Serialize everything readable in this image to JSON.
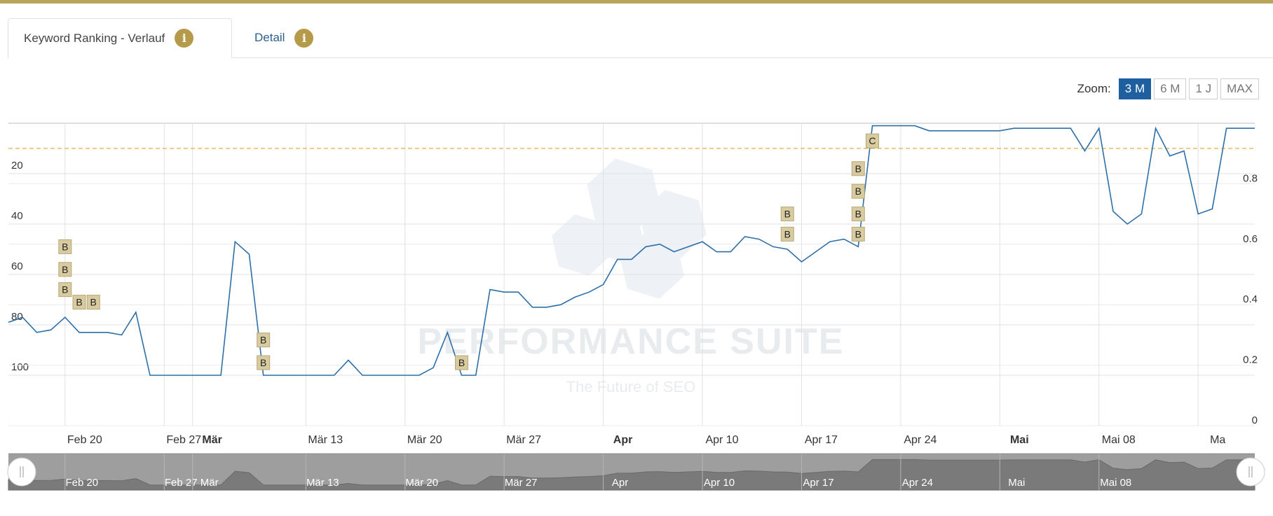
{
  "tabs": [
    {
      "label": "Keyword Ranking - Verlauf",
      "icon": "info-icon",
      "active": true
    },
    {
      "label": "Detail",
      "icon": "info-icon",
      "active": false
    }
  ],
  "zoom": {
    "label": "Zoom:",
    "options": [
      "3 M",
      "6 M",
      "1 J",
      "MAX"
    ],
    "selected": "3 M"
  },
  "watermark": {
    "title": "PERFORMANCE SUITE",
    "subtitle": "The Future of SEO"
  },
  "colors": {
    "topbar": "#b9a55a",
    "line": "#2e6fa8",
    "threshold": "#e0b040",
    "marker_fill": "#d8cba0",
    "marker_stroke": "#b8a878",
    "zoom_active": "#1e5fa0",
    "info_icon": "#b59a4a"
  },
  "chart_data": {
    "type": "line",
    "title": "",
    "xlabel": "",
    "ylabel": "",
    "y_left": {
      "ticks": [
        "20",
        "40",
        "60",
        "80",
        "100"
      ],
      "reversed": true,
      "range": [
        0,
        120
      ]
    },
    "y_right": {
      "ticks": [
        "0",
        "0.2",
        "0.4",
        "0.6",
        "0.8"
      ],
      "range": [
        0,
        1
      ]
    },
    "x_range": [
      "2023-02-16",
      "2023-05-15"
    ],
    "x_ticks": [
      {
        "label": "Feb 20",
        "date": "2023-02-20",
        "bold": false
      },
      {
        "label": "Feb 27",
        "date": "2023-02-27",
        "bold": false
      },
      {
        "label": "Mär",
        "date": "2023-03-01",
        "bold": true
      },
      {
        "label": "Mär 13",
        "date": "2023-03-09",
        "bold": false
      },
      {
        "label": "Mär 20",
        "date": "2023-03-16",
        "bold": false
      },
      {
        "label": "Mär 27",
        "date": "2023-03-23",
        "bold": false
      },
      {
        "label": "Apr",
        "date": "2023-03-30",
        "bold": true
      },
      {
        "label": "Apr 10",
        "date": "2023-04-06",
        "bold": false
      },
      {
        "label": "Apr 17",
        "date": "2023-04-13",
        "bold": false
      },
      {
        "label": "Apr 24",
        "date": "2023-04-20",
        "bold": false
      },
      {
        "label": "Mai",
        "date": "2023-04-27",
        "bold": true
      },
      {
        "label": "Mai 08",
        "date": "2023-05-04",
        "bold": false
      },
      {
        "label": "Ma",
        "date": "2023-05-11",
        "bold": false
      }
    ],
    "threshold": {
      "y": 10,
      "style": "dashed"
    },
    "grid": true,
    "series": [
      {
        "points": [
          [
            "2023-02-16",
            79
          ],
          [
            "2023-02-17",
            77
          ],
          [
            "2023-02-18",
            83
          ],
          [
            "2023-02-19",
            82
          ],
          [
            "2023-02-20",
            77
          ],
          [
            "2023-02-21",
            83
          ],
          [
            "2023-02-22",
            83
          ],
          [
            "2023-02-23",
            83
          ],
          [
            "2023-02-24",
            84
          ],
          [
            "2023-02-25",
            75
          ],
          [
            "2023-02-26",
            100
          ],
          [
            "2023-02-27",
            100
          ],
          [
            "2023-02-28",
            100
          ],
          [
            "2023-03-01",
            100
          ],
          [
            "2023-03-02",
            100
          ],
          [
            "2023-03-03",
            100
          ],
          [
            "2023-03-04",
            47
          ],
          [
            "2023-03-05",
            52
          ],
          [
            "2023-03-06",
            100
          ],
          [
            "2023-03-07",
            100
          ],
          [
            "2023-03-08",
            100
          ],
          [
            "2023-03-09",
            100
          ],
          [
            "2023-03-10",
            100
          ],
          [
            "2023-03-11",
            100
          ],
          [
            "2023-03-12",
            94
          ],
          [
            "2023-03-13",
            100
          ],
          [
            "2023-03-14",
            100
          ],
          [
            "2023-03-15",
            100
          ],
          [
            "2023-03-16",
            100
          ],
          [
            "2023-03-17",
            100
          ],
          [
            "2023-03-18",
            97
          ],
          [
            "2023-03-19",
            83
          ],
          [
            "2023-03-20",
            100
          ],
          [
            "2023-03-21",
            100
          ],
          [
            "2023-03-22",
            66
          ],
          [
            "2023-03-23",
            67
          ],
          [
            "2023-03-24",
            67
          ],
          [
            "2023-03-25",
            73
          ],
          [
            "2023-03-26",
            73
          ],
          [
            "2023-03-27",
            72
          ],
          [
            "2023-03-28",
            69
          ],
          [
            "2023-03-29",
            67
          ],
          [
            "2023-03-30",
            64
          ],
          [
            "2023-03-31",
            54
          ],
          [
            "2023-04-01",
            54
          ],
          [
            "2023-04-02",
            49
          ],
          [
            "2023-04-03",
            48
          ],
          [
            "2023-04-04",
            51
          ],
          [
            "2023-04-05",
            49
          ],
          [
            "2023-04-06",
            47
          ],
          [
            "2023-04-07",
            51
          ],
          [
            "2023-04-08",
            51
          ],
          [
            "2023-04-09",
            45
          ],
          [
            "2023-04-10",
            46
          ],
          [
            "2023-04-11",
            49
          ],
          [
            "2023-04-12",
            50
          ],
          [
            "2023-04-13",
            55
          ],
          [
            "2023-04-14",
            51
          ],
          [
            "2023-04-15",
            47
          ],
          [
            "2023-04-16",
            46
          ],
          [
            "2023-04-17",
            49
          ],
          [
            "2023-04-18",
            1
          ],
          [
            "2023-04-19",
            1
          ],
          [
            "2023-04-20",
            1
          ],
          [
            "2023-04-21",
            1
          ],
          [
            "2023-04-22",
            3
          ],
          [
            "2023-04-23",
            3
          ],
          [
            "2023-04-24",
            3
          ],
          [
            "2023-04-25",
            3
          ],
          [
            "2023-04-26",
            3
          ],
          [
            "2023-04-27",
            3
          ],
          [
            "2023-04-28",
            2
          ],
          [
            "2023-04-29",
            2
          ],
          [
            "2023-04-30",
            2
          ],
          [
            "2023-05-01",
            2
          ],
          [
            "2023-05-02",
            2
          ],
          [
            "2023-05-03",
            11
          ],
          [
            "2023-05-04",
            2
          ],
          [
            "2023-05-05",
            35
          ],
          [
            "2023-05-06",
            40
          ],
          [
            "2023-05-07",
            36
          ],
          [
            "2023-05-08",
            2
          ],
          [
            "2023-05-09",
            13
          ],
          [
            "2023-05-10",
            11
          ],
          [
            "2023-05-11",
            36
          ],
          [
            "2023-05-12",
            34
          ],
          [
            "2023-05-13",
            2
          ],
          [
            "2023-05-14",
            2
          ],
          [
            "2023-05-15",
            2
          ]
        ]
      }
    ],
    "markers": [
      {
        "label": "B",
        "date": "2023-02-20",
        "y": 49
      },
      {
        "label": "B",
        "date": "2023-02-20",
        "y": 58
      },
      {
        "label": "B",
        "date": "2023-02-20",
        "y": 66
      },
      {
        "label": "B",
        "date": "2023-02-21",
        "y": 71
      },
      {
        "label": "B",
        "date": "2023-02-22",
        "y": 71
      },
      {
        "label": "B",
        "date": "2023-03-06",
        "y": 86
      },
      {
        "label": "B",
        "date": "2023-03-06",
        "y": 95
      },
      {
        "label": "B",
        "date": "2023-03-20",
        "y": 95
      },
      {
        "label": "B",
        "date": "2023-04-12",
        "y": 36
      },
      {
        "label": "B",
        "date": "2023-04-12",
        "y": 44
      },
      {
        "label": "B",
        "date": "2023-04-17",
        "y": 18
      },
      {
        "label": "B",
        "date": "2023-04-17",
        "y": 27
      },
      {
        "label": "B",
        "date": "2023-04-17",
        "y": 36
      },
      {
        "label": "B",
        "date": "2023-04-17",
        "y": 44
      },
      {
        "label": "C",
        "date": "2023-04-18",
        "y": 7
      }
    ],
    "navigator": {
      "x_labels": [
        "Feb 20",
        "Feb 27",
        "Mär",
        "Mär 13",
        "Mär 20",
        "Mär 27",
        "Apr",
        "Apr 10",
        "Apr 17",
        "Apr 24",
        "Mai",
        "Mai 08"
      ]
    }
  }
}
